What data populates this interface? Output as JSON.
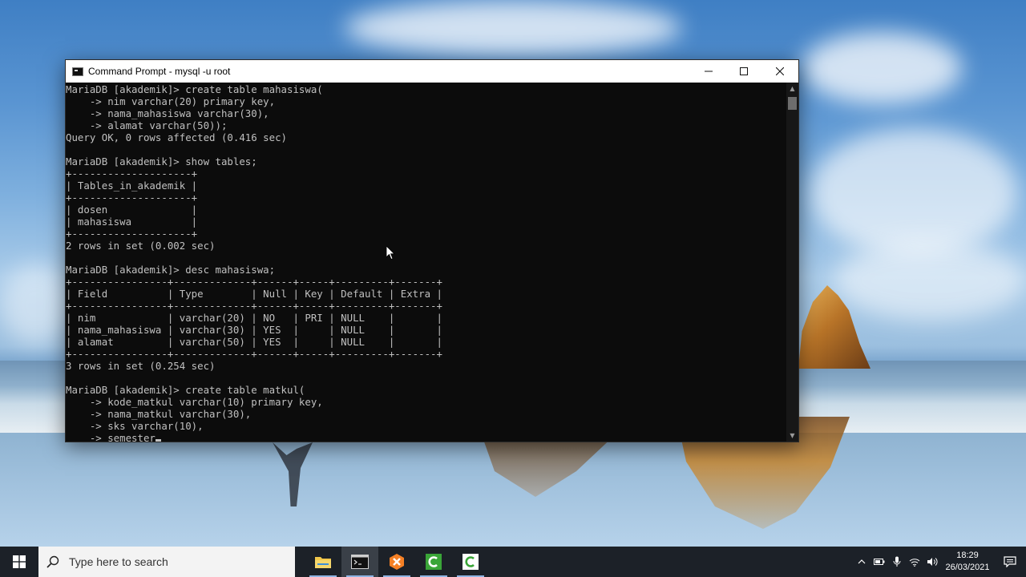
{
  "window": {
    "title": "Command Prompt - mysql  -u root",
    "controls": {
      "minimize": "—",
      "maximize": "☐",
      "close": "✕"
    }
  },
  "console_lines": [
    "MariaDB [akademik]> create table mahasiswa(",
    "    -> nim varchar(20) primary key,",
    "    -> nama_mahasiswa varchar(30),",
    "    -> alamat varchar(50));",
    "Query OK, 0 rows affected (0.416 sec)",
    "",
    "MariaDB [akademik]> show tables;",
    "+--------------------+",
    "| Tables_in_akademik |",
    "+--------------------+",
    "| dosen              |",
    "| mahasiswa          |",
    "+--------------------+",
    "2 rows in set (0.002 sec)",
    "",
    "MariaDB [akademik]> desc mahasiswa;",
    "+----------------+-------------+------+-----+---------+-------+",
    "| Field          | Type        | Null | Key | Default | Extra |",
    "+----------------+-------------+------+-----+---------+-------+",
    "| nim            | varchar(20) | NO   | PRI | NULL    |       |",
    "| nama_mahasiswa | varchar(30) | YES  |     | NULL    |       |",
    "| alamat         | varchar(50) | YES  |     | NULL    |       |",
    "+----------------+-------------+------+-----+---------+-------+",
    "3 rows in set (0.254 sec)",
    "",
    "MariaDB [akademik]> create table matkul(",
    "    -> kode_matkul varchar(10) primary key,",
    "    -> nama_matkul varchar(30),",
    "    -> sks varchar(10),",
    "    -> semester"
  ],
  "taskbar": {
    "search_placeholder": "Type here to search",
    "apps": [
      {
        "name": "file-explorer",
        "icon_color": "#f2c84b"
      },
      {
        "name": "command-prompt",
        "icon_color": "#1a1a1a"
      },
      {
        "name": "xampp",
        "icon_color": "#f58025"
      },
      {
        "name": "camtasia-green",
        "icon_color": "#3aa538"
      },
      {
        "name": "camtasia-white",
        "icon_color": "#ffffff"
      }
    ],
    "time": "18:29",
    "date": "26/03/2021"
  }
}
